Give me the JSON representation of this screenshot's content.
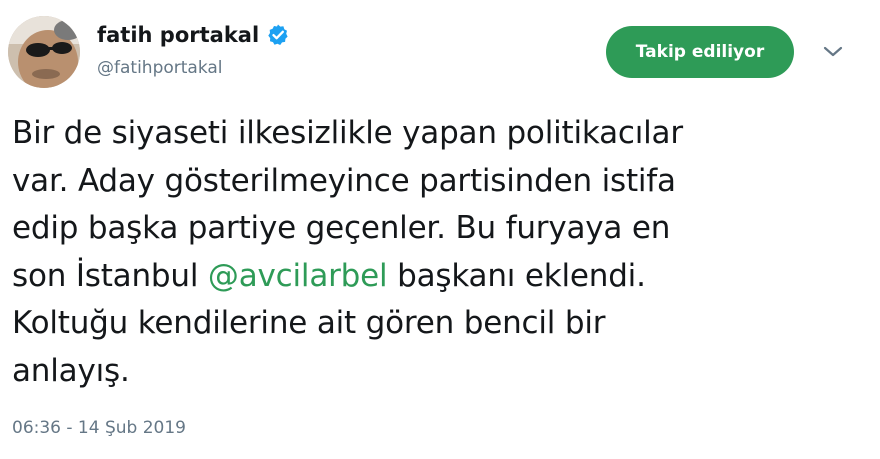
{
  "user": {
    "display_name": "fatih portakal",
    "handle": "@fatihportakal",
    "verified": true
  },
  "follow_button": {
    "label": "Takip ediliyor",
    "color": "#2e9b57"
  },
  "more_menu": {
    "icon": "chevron-down-icon"
  },
  "tweet": {
    "text_before": "Bir de siyaseti ilkesizlikle yapan politikacılar\nvar. Aday gösterilmeyince partisinden istifa\nedip başka partiye geçenler. Bu furyaya en\nson İstanbul ",
    "mention": "@avcilarbel",
    "text_after": " başkanı eklendi.\nKoltuğu kendilerine ait gören bencil bir\nanlayış.",
    "mention_color": "#2e9b57"
  },
  "timestamp": "06:36 - 14 Şub 2019",
  "colors": {
    "verified_badge": "#1da1f2",
    "secondary_text": "#657786"
  }
}
